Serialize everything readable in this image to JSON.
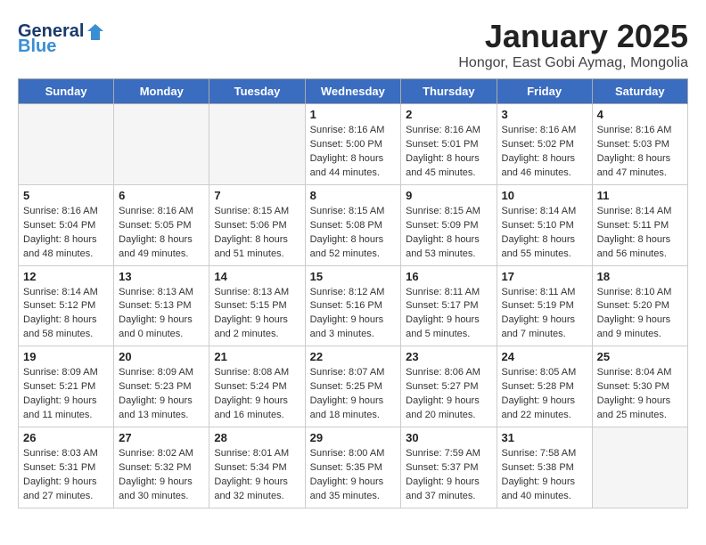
{
  "header": {
    "title": "January 2025",
    "subtitle": "Hongor, East Gobi Aymag, Mongolia",
    "logo_general": "General",
    "logo_blue": "Blue"
  },
  "weekdays": [
    "Sunday",
    "Monday",
    "Tuesday",
    "Wednesday",
    "Thursday",
    "Friday",
    "Saturday"
  ],
  "weeks": [
    [
      {
        "num": "",
        "info": ""
      },
      {
        "num": "",
        "info": ""
      },
      {
        "num": "",
        "info": ""
      },
      {
        "num": "1",
        "info": "Sunrise: 8:16 AM\nSunset: 5:00 PM\nDaylight: 8 hours\nand 44 minutes."
      },
      {
        "num": "2",
        "info": "Sunrise: 8:16 AM\nSunset: 5:01 PM\nDaylight: 8 hours\nand 45 minutes."
      },
      {
        "num": "3",
        "info": "Sunrise: 8:16 AM\nSunset: 5:02 PM\nDaylight: 8 hours\nand 46 minutes."
      },
      {
        "num": "4",
        "info": "Sunrise: 8:16 AM\nSunset: 5:03 PM\nDaylight: 8 hours\nand 47 minutes."
      }
    ],
    [
      {
        "num": "5",
        "info": "Sunrise: 8:16 AM\nSunset: 5:04 PM\nDaylight: 8 hours\nand 48 minutes."
      },
      {
        "num": "6",
        "info": "Sunrise: 8:16 AM\nSunset: 5:05 PM\nDaylight: 8 hours\nand 49 minutes."
      },
      {
        "num": "7",
        "info": "Sunrise: 8:15 AM\nSunset: 5:06 PM\nDaylight: 8 hours\nand 51 minutes."
      },
      {
        "num": "8",
        "info": "Sunrise: 8:15 AM\nSunset: 5:08 PM\nDaylight: 8 hours\nand 52 minutes."
      },
      {
        "num": "9",
        "info": "Sunrise: 8:15 AM\nSunset: 5:09 PM\nDaylight: 8 hours\nand 53 minutes."
      },
      {
        "num": "10",
        "info": "Sunrise: 8:14 AM\nSunset: 5:10 PM\nDaylight: 8 hours\nand 55 minutes."
      },
      {
        "num": "11",
        "info": "Sunrise: 8:14 AM\nSunset: 5:11 PM\nDaylight: 8 hours\nand 56 minutes."
      }
    ],
    [
      {
        "num": "12",
        "info": "Sunrise: 8:14 AM\nSunset: 5:12 PM\nDaylight: 8 hours\nand 58 minutes."
      },
      {
        "num": "13",
        "info": "Sunrise: 8:13 AM\nSunset: 5:13 PM\nDaylight: 9 hours\nand 0 minutes."
      },
      {
        "num": "14",
        "info": "Sunrise: 8:13 AM\nSunset: 5:15 PM\nDaylight: 9 hours\nand 2 minutes."
      },
      {
        "num": "15",
        "info": "Sunrise: 8:12 AM\nSunset: 5:16 PM\nDaylight: 9 hours\nand 3 minutes."
      },
      {
        "num": "16",
        "info": "Sunrise: 8:11 AM\nSunset: 5:17 PM\nDaylight: 9 hours\nand 5 minutes."
      },
      {
        "num": "17",
        "info": "Sunrise: 8:11 AM\nSunset: 5:19 PM\nDaylight: 9 hours\nand 7 minutes."
      },
      {
        "num": "18",
        "info": "Sunrise: 8:10 AM\nSunset: 5:20 PM\nDaylight: 9 hours\nand 9 minutes."
      }
    ],
    [
      {
        "num": "19",
        "info": "Sunrise: 8:09 AM\nSunset: 5:21 PM\nDaylight: 9 hours\nand 11 minutes."
      },
      {
        "num": "20",
        "info": "Sunrise: 8:09 AM\nSunset: 5:23 PM\nDaylight: 9 hours\nand 13 minutes."
      },
      {
        "num": "21",
        "info": "Sunrise: 8:08 AM\nSunset: 5:24 PM\nDaylight: 9 hours\nand 16 minutes."
      },
      {
        "num": "22",
        "info": "Sunrise: 8:07 AM\nSunset: 5:25 PM\nDaylight: 9 hours\nand 18 minutes."
      },
      {
        "num": "23",
        "info": "Sunrise: 8:06 AM\nSunset: 5:27 PM\nDaylight: 9 hours\nand 20 minutes."
      },
      {
        "num": "24",
        "info": "Sunrise: 8:05 AM\nSunset: 5:28 PM\nDaylight: 9 hours\nand 22 minutes."
      },
      {
        "num": "25",
        "info": "Sunrise: 8:04 AM\nSunset: 5:30 PM\nDaylight: 9 hours\nand 25 minutes."
      }
    ],
    [
      {
        "num": "26",
        "info": "Sunrise: 8:03 AM\nSunset: 5:31 PM\nDaylight: 9 hours\nand 27 minutes."
      },
      {
        "num": "27",
        "info": "Sunrise: 8:02 AM\nSunset: 5:32 PM\nDaylight: 9 hours\nand 30 minutes."
      },
      {
        "num": "28",
        "info": "Sunrise: 8:01 AM\nSunset: 5:34 PM\nDaylight: 9 hours\nand 32 minutes."
      },
      {
        "num": "29",
        "info": "Sunrise: 8:00 AM\nSunset: 5:35 PM\nDaylight: 9 hours\nand 35 minutes."
      },
      {
        "num": "30",
        "info": "Sunrise: 7:59 AM\nSunset: 5:37 PM\nDaylight: 9 hours\nand 37 minutes."
      },
      {
        "num": "31",
        "info": "Sunrise: 7:58 AM\nSunset: 5:38 PM\nDaylight: 9 hours\nand 40 minutes."
      },
      {
        "num": "",
        "info": ""
      }
    ]
  ]
}
